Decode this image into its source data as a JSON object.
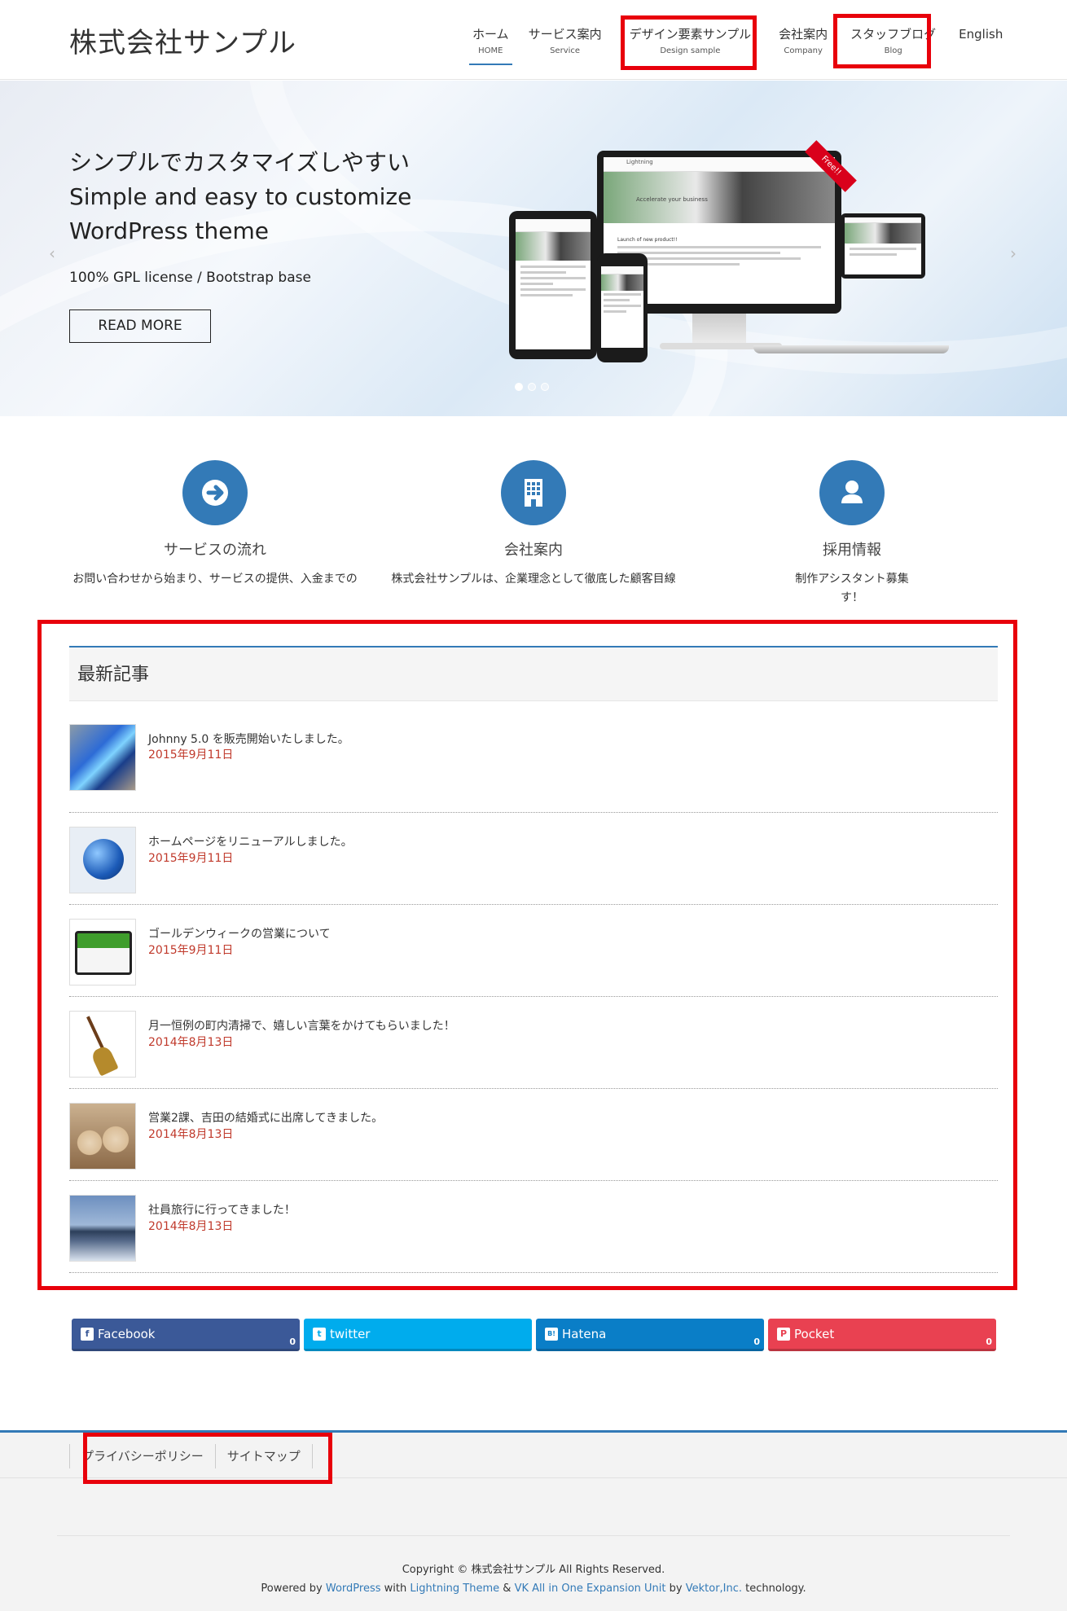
{
  "header": {
    "logo": "株式会社サンプル",
    "nav": [
      {
        "jp": "ホーム",
        "en": "HOME"
      },
      {
        "jp": "サービス案内",
        "en": "Service"
      },
      {
        "jp": "デザイン要素サンプル",
        "en": "Design sample"
      },
      {
        "jp": "会社案内",
        "en": "Company"
      },
      {
        "jp": "スタッフブログ",
        "en": "Blog"
      },
      {
        "jp": "English",
        "en": ""
      }
    ]
  },
  "hero": {
    "title_line1": "シンプルでカスタマイズしやすい",
    "title_line2": "Simple and easy to customize",
    "title_line3": "WordPress theme",
    "subtitle": "100% GPL license / Bootstrap base",
    "button": "READ MORE",
    "prev_arrow": "‹",
    "next_arrow": "›",
    "ribbon": "Free!!",
    "device_brand": "Lightning",
    "device_tagline": "Accelerate your business",
    "device_post": "Launch of new product!!"
  },
  "features": [
    {
      "title": "サービスの流れ",
      "desc": "お問い合わせから始まり、サービスの提供、入金までの",
      "desc2": "",
      "icon": "arrow-right-icon"
    },
    {
      "title": "会社案内",
      "desc": "株式会社サンプルは、企業理念として徹底した顧客目線",
      "desc2": "",
      "icon": "building-icon"
    },
    {
      "title": "採用情報",
      "desc": "制作アシスタント募集",
      "desc2": "す！",
      "icon": "user-icon"
    }
  ],
  "posts": {
    "heading": "最新記事",
    "items": [
      {
        "title": "Johnny 5.0 を販売開始いたしました。",
        "date": "2015年9月11日",
        "thumb": "laptop"
      },
      {
        "title": "ホームページをリニューアルしました。",
        "date": "2015年9月11日",
        "thumb": "globe"
      },
      {
        "title": "ゴールデンウィークの営業について",
        "date": "2015年9月11日",
        "thumb": "calendar"
      },
      {
        "title": "月一恒例の町内清掃で、嬉しい言葉をかけてもらいました！",
        "date": "2014年8月13日",
        "thumb": "broom"
      },
      {
        "title": "営業2課、吉田の結婚式に出席してきました。",
        "date": "2014年8月13日",
        "thumb": "bears"
      },
      {
        "title": "社員旅行に行ってきました！",
        "date": "2014年8月13日",
        "thumb": "mountain"
      }
    ]
  },
  "social": [
    {
      "label": "Facebook",
      "count": "0",
      "color": "#3b5998",
      "icon": "f"
    },
    {
      "label": "twitter",
      "count": "",
      "color": "#00aced",
      "icon": "t"
    },
    {
      "label": "Hatena",
      "count": "0",
      "color": "#0a7ec7",
      "icon": "B!"
    },
    {
      "label": "Pocket",
      "count": "0",
      "color": "#e94151",
      "icon": "P"
    }
  ],
  "footer": {
    "links": [
      "プライバシーポリシー",
      "サイトマップ"
    ],
    "copyright": "Copyright © 株式会社サンプル All Rights Reserved.",
    "powered_prefix": "Powered by",
    "wp": "WordPress",
    "with": "with",
    "lightning": "Lightning Theme",
    "amp": "&",
    "vk": "VK All in One Expansion Unit",
    "by": "by",
    "vektor": "Vektor,Inc.",
    "tech": "technology."
  }
}
